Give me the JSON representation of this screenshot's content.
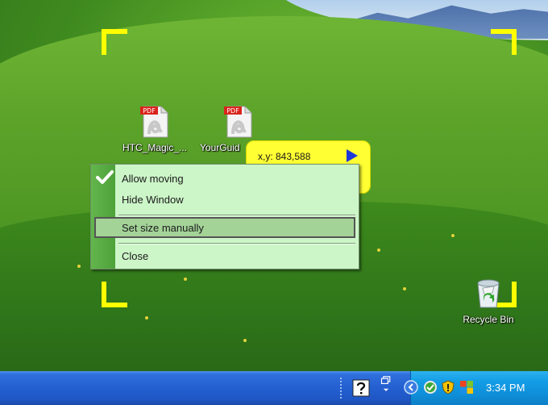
{
  "desktop": {
    "icons": [
      {
        "label": "HTC_Magic_...",
        "type": "PDF"
      },
      {
        "label": "YourGuid",
        "type": "PDF"
      }
    ],
    "recycle_bin": {
      "label": "Recycle Bin"
    }
  },
  "coordinate_bubble": {
    "text": "x,y: 843,588"
  },
  "context_menu": {
    "items": [
      {
        "label": "Allow moving",
        "checked": true
      },
      {
        "label": "Hide Window",
        "checked": false
      },
      {
        "label": "Set size manually",
        "highlighted": true
      },
      {
        "label": "Close"
      }
    ]
  },
  "taskbar": {
    "quick_launch": [
      "help-icon",
      "restore-windows-icon"
    ],
    "tray_icons": [
      "tray-expand-icon",
      "network-icon",
      "security-shield-icon",
      "windows-flag-icon"
    ],
    "clock": "3:34 PM"
  },
  "colors": {
    "capture_corner": "#ffff00",
    "menu_background": "#ccf5c8",
    "menu_gutter": "#4ea13a",
    "menu_highlight": "#a4d398",
    "bubble": "#ffff33",
    "taskbar": "#245fd0",
    "tray": "#139de6"
  }
}
